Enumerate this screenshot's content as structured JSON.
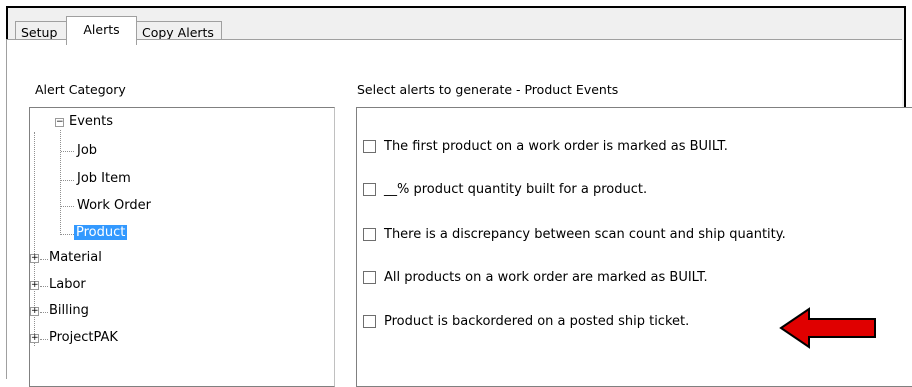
{
  "tabs": [
    "Setup",
    "Alerts",
    "Copy Alerts"
  ],
  "active_tab": "Alerts",
  "alert_category": {
    "label": "Alert Category",
    "tree": {
      "events": "Events",
      "job": "Job",
      "job_item": "Job Item",
      "work_order": "Work Order",
      "product": "Product",
      "material": "Material",
      "labor": "Labor",
      "billing": "Billing",
      "projectpak": "ProjectPAK"
    },
    "selected": "Product"
  },
  "alerts_panel": {
    "label": "Select alerts to generate - Product Events",
    "items": [
      {
        "text": "The first product on a work order is marked as BUILT.",
        "checked": false
      },
      {
        "text": "__% product quantity built for a product.",
        "checked": false
      },
      {
        "text": "There is a discrepancy between scan count and ship quantity.",
        "checked": false
      },
      {
        "text": "All products on a work order are marked as BUILT.",
        "checked": false
      },
      {
        "text": "Product is backordered on a posted ship ticket.",
        "checked": false
      }
    ]
  },
  "colors": {
    "selection": "#3399ff",
    "arrow": "#e00000"
  },
  "icons": {
    "collapse": "minus-box",
    "expand": "plus-box",
    "pointer": "left-arrow"
  }
}
